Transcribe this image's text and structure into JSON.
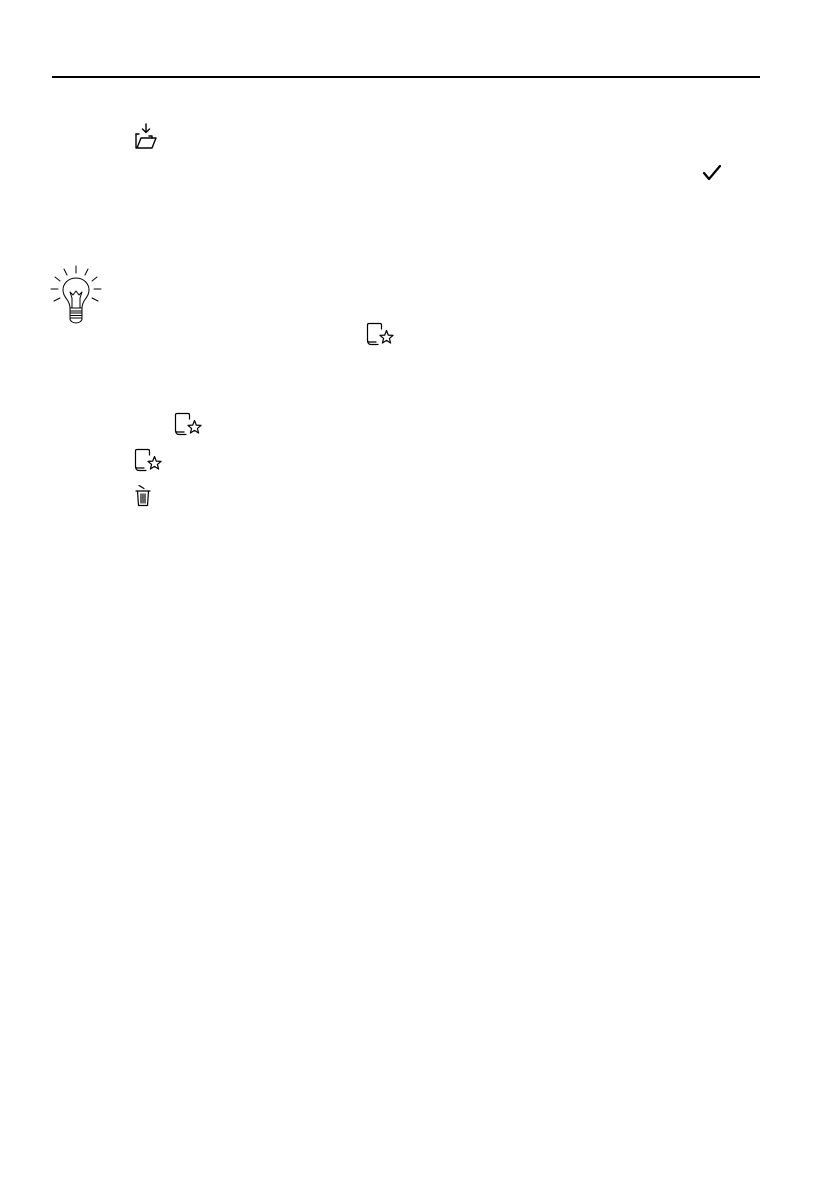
{
  "page": {
    "background": "#ffffff",
    "rule_color": "#000000"
  },
  "icons": [
    {
      "id": "import-folder",
      "semantic": "folder-import-icon"
    },
    {
      "id": "check",
      "semantic": "checkmark-icon"
    },
    {
      "id": "tip",
      "semantic": "lightbulb-icon"
    },
    {
      "id": "favorite-1",
      "semantic": "favorite-document-icon"
    },
    {
      "id": "favorite-2",
      "semantic": "favorite-document-icon"
    },
    {
      "id": "favorite-3",
      "semantic": "favorite-document-icon"
    },
    {
      "id": "trash",
      "semantic": "trash-icon"
    }
  ]
}
